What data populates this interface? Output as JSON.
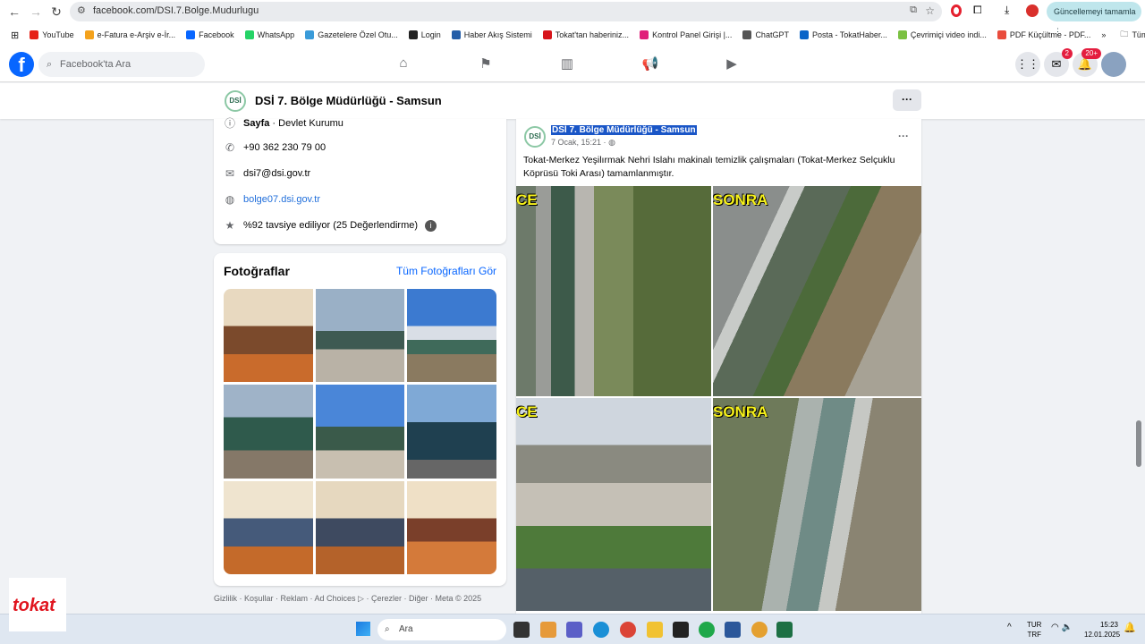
{
  "browser": {
    "url": "facebook.com/DSI.7.Bolge.Mudurlugu",
    "update_label": "Güncellemeyi tamamla",
    "bookmarks": [
      {
        "label": "YouTube",
        "color": "#e62117"
      },
      {
        "label": "e-Fatura e-Arşiv e-İr...",
        "color": "#f4a21c"
      },
      {
        "label": "Facebook",
        "color": "#0866ff"
      },
      {
        "label": "WhatsApp",
        "color": "#25d366"
      },
      {
        "label": "Gazetelere Özel Otu...",
        "color": "#3a9bd9"
      },
      {
        "label": "Login",
        "color": "#222"
      },
      {
        "label": "Haber Akış Sistemi",
        "color": "#245ea8"
      },
      {
        "label": "Tokat'tan haberiniz...",
        "color": "#d7141a"
      },
      {
        "label": "Kontrol Panel Girişi |...",
        "color": "#e0207a"
      },
      {
        "label": "ChatGPT",
        "color": "#555"
      },
      {
        "label": "Posta - TokatHaber...",
        "color": "#0a64c8"
      },
      {
        "label": "Çevrimiçi video indi...",
        "color": "#7bc142"
      },
      {
        "label": "PDF Küçültme - PDF...",
        "color": "#e94c3d"
      }
    ],
    "all_bookmarks": "Tüm Yer İşaretleri"
  },
  "facebook": {
    "search_placeholder": "Facebook'ta Ara",
    "messenger_badge": "2",
    "notif_badge": "20+"
  },
  "page": {
    "title": "DSİ 7. Bölge Müdürlüğü - Samsun",
    "intro": {
      "category_bold": "Sayfa",
      "category": " · Devlet Kurumu",
      "phone": "+90 362 230 79 00",
      "email": "dsi7@dsi.gov.tr",
      "website": "bolge07.dsi.gov.tr",
      "rating": "%92 tavsiye ediliyor (25 Değerlendirme)"
    },
    "photos": {
      "heading": "Fotoğraflar",
      "see_all": "Tüm Fotoğrafları Gör"
    },
    "footer": "Gizlilik · Koşullar · Reklam · Ad Choices ▷ · Çerezler · Diğer · Meta © 2025"
  },
  "post": {
    "author": "DSİ 7. Bölge Müdürlüğü - Samsun",
    "time": "7 Ocak, 15:21 ·",
    "text": "Tokat-Merkez Yeşilırmak Nehri Islahı makinalı temizlik çalışmaları (Tokat-Merkez Selçuklu Köprüsü Toki Arası) tamamlanmıştır.",
    "image_labels": [
      "CE",
      "SONRA",
      "CE",
      "SONRA"
    ]
  },
  "taskbar": {
    "search": "Ara",
    "lang1": "TUR",
    "lang2": "TRF",
    "time": "15:23",
    "date": "12.01.2025",
    "corner_logo": "tokat haber"
  }
}
